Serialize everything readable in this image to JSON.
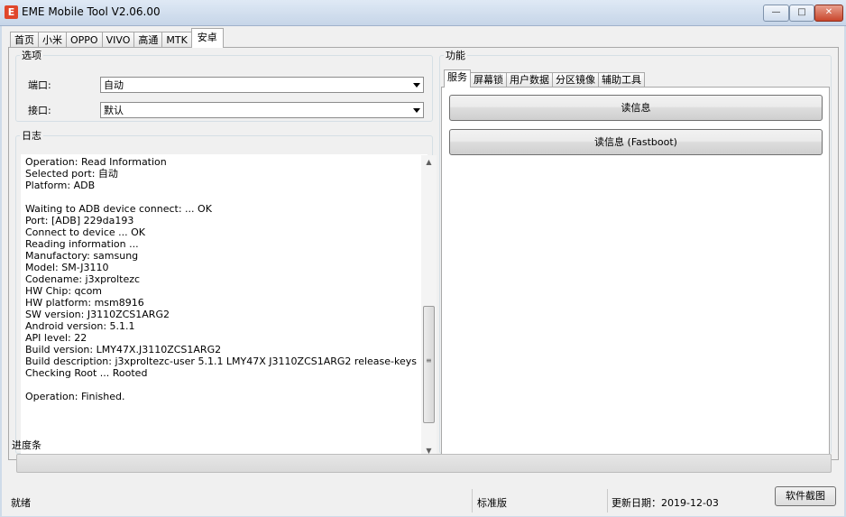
{
  "window": {
    "title": "EME Mobile Tool V2.06.00",
    "icon_letter": "E",
    "controls": {
      "minimize": "—",
      "maximize": "□",
      "close": "✕"
    }
  },
  "main_tabs": [
    "首页",
    "小米",
    "OPPO",
    "VIVO",
    "高通",
    "MTK",
    "安卓"
  ],
  "active_main_tab": "安卓",
  "options": {
    "legend": "选项",
    "port_label": "端口:",
    "port_value": "自动",
    "interface_label": "接口:",
    "interface_value": "默认"
  },
  "log": {
    "legend": "日志",
    "lines": [
      "Operation: Read Information",
      "Selected port: 自动",
      "Platform: ADB",
      "",
      "Waiting to ADB device connect: ... OK",
      "Port: [ADB] 229da193",
      "Connect to device ... OK",
      "Reading information ...",
      "Manufactory: samsung",
      "Model: SM-J3110",
      "Codename: j3xproltezc",
      "HW Chip: qcom",
      "HW platform: msm8916",
      "SW version: J3110ZCS1ARG2",
      "Android version: 5.1.1",
      "API level: 22",
      "Build version: LMY47X.J3110ZCS1ARG2",
      "Build description: j3xproltezc-user 5.1.1 LMY47X J3110ZCS1ARG2 release-keys",
      "Checking Root ... Rooted",
      "",
      "Operation: Finished."
    ]
  },
  "functions": {
    "legend": "功能",
    "tabs": [
      "服务",
      "屏幕锁",
      "用户数据",
      "分区镜像",
      "辅助工具"
    ],
    "active_tab": "服务",
    "buttons": [
      "读信息",
      "读信息 (Fastboot)"
    ]
  },
  "progress": {
    "label": "进度条",
    "value": 0
  },
  "status": {
    "state": "就绪",
    "edition": "标准版",
    "update_date": "更新日期：2019-12-03",
    "screenshot_button": "软件截图"
  }
}
